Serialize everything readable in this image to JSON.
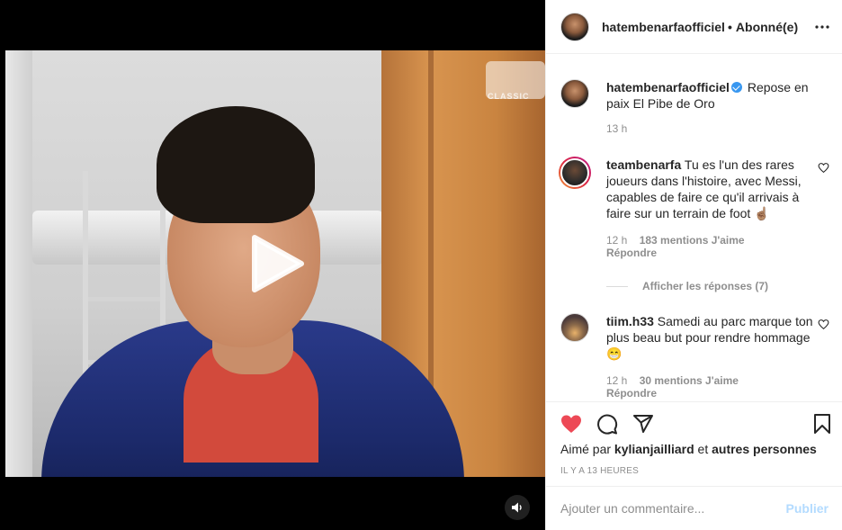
{
  "video": {
    "channel_logo_text": "ESPN",
    "channel_sub_text": "CLASSIC"
  },
  "header": {
    "username": "hatembenarfaofficiel",
    "separator": "•",
    "follow_status": "Abonné(e)"
  },
  "caption": {
    "username": "hatembenarfaofficiel",
    "text": "Repose en paix El Pibe de Oro",
    "time": "13 h"
  },
  "comments": [
    {
      "username": "teambenarfa",
      "text": "Tu es l'un des rares joueurs dans l'histoire, avec Messi, capables de faire ce qu'il arrivais à faire sur un terrain de foot ☝🏽",
      "time": "12 h",
      "likes": "183 mentions J'aime",
      "reply": "Répondre",
      "view_replies": "Afficher les réponses (7)"
    },
    {
      "username": "tiim.h33",
      "text": "Samedi au parc marque ton plus beau but pour rendre hommage 😁",
      "time": "12 h",
      "likes": "30 mentions J'aime",
      "reply": "Répondre"
    }
  ],
  "liked_by": {
    "prefix": "Aimé par",
    "user": "kylianjailliard",
    "conjunction": "et",
    "others": "autres personnes"
  },
  "timestamp": "Il y a 13 heures",
  "add_comment": {
    "placeholder": "Ajouter un commentaire...",
    "publish_label": "Publier"
  },
  "colors": {
    "like_red": "#ed4956",
    "verified_blue": "#3897f0",
    "publish_disabled": "#b3dbff"
  },
  "icons": [
    "play-icon",
    "volume-icon",
    "more-icon",
    "heart-icon",
    "comment-icon",
    "share-icon",
    "bookmark-icon"
  ]
}
